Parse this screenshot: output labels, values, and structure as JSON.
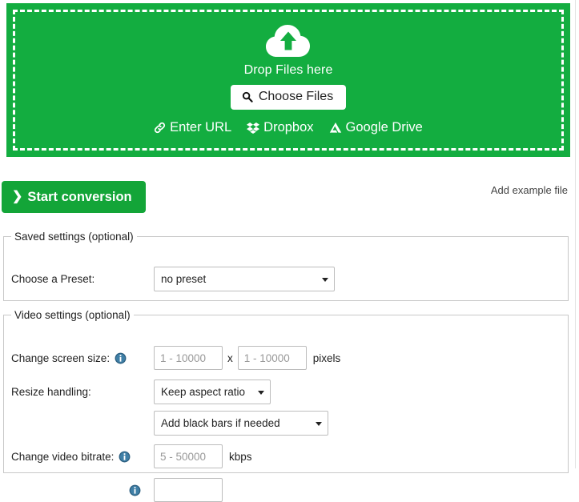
{
  "dropzone": {
    "icon": "cloud-upload-icon",
    "drop_text": "Drop Files here",
    "choose_files_label": "Choose Files",
    "choose_files_icon": "search-icon",
    "sources": [
      {
        "label": "Enter URL",
        "icon": "link-icon"
      },
      {
        "label": "Dropbox",
        "icon": "dropbox-icon"
      },
      {
        "label": "Google Drive",
        "icon": "google-drive-icon"
      }
    ],
    "background_color": "#13ad40",
    "border_style": "dashed-white"
  },
  "actions": {
    "start_conversion_label": "Start conversion",
    "start_conversion_icon": "chevron-right-icon",
    "start_button_color": "#13a538",
    "add_example_label": "Add example file"
  },
  "saved_settings": {
    "legend": "Saved settings (optional)",
    "preset_label": "Choose a Preset:",
    "preset_value": "no preset",
    "preset_options": [
      "no preset"
    ]
  },
  "video_settings": {
    "legend": "Video settings (optional)",
    "screen_size": {
      "label": "Change screen size:",
      "info_icon": "info-icon",
      "width_placeholder": "1 - 10000",
      "width_value": "",
      "separator": "x",
      "height_placeholder": "1 - 10000",
      "height_value": "",
      "unit": "pixels"
    },
    "resize_handling": {
      "label": "Resize handling:",
      "aspect_value": "Keep aspect ratio",
      "aspect_options": [
        "Keep aspect ratio"
      ],
      "bars_value": "Add black bars if needed",
      "bars_options": [
        "Add black bars if needed"
      ]
    },
    "video_bitrate": {
      "label": "Change video bitrate:",
      "info_icon": "info-icon",
      "placeholder": "5 - 50000",
      "value": "",
      "unit": "kbps"
    },
    "next_row": {
      "info_icon": "info-icon"
    }
  }
}
